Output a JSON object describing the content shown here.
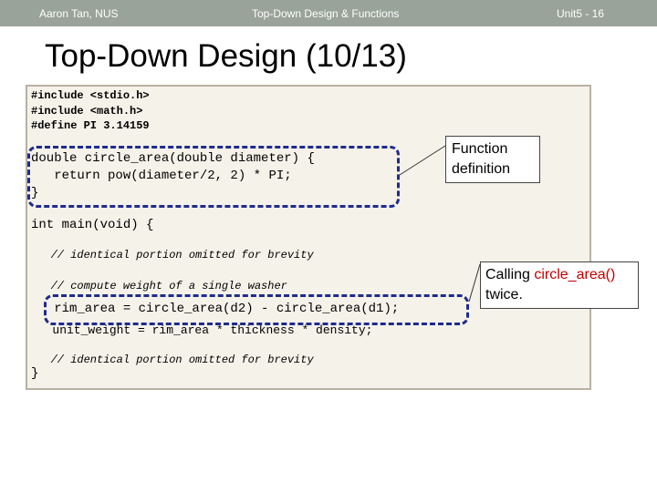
{
  "header": {
    "left": "Aaron Tan, NUS",
    "center": "Top-Down Design & Functions",
    "right": "Unit5 - 16"
  },
  "slide_title": "Top-Down Design (10/13)",
  "code": {
    "include1": "#include <stdio.h>",
    "include2": "#include <math.h>",
    "define": "#define PI 3.14159",
    "func_line1": "double circle_area(double diameter) {",
    "func_line2": "   return pow(diameter/2, 2) * PI;",
    "func_close": "}",
    "main_open": "int main(void) {",
    "comment1": "   // identical portion omitted for brevity",
    "comment2": "   // compute weight of a single washer",
    "rim_line": "   rim_area = circle_area(d2) - circle_area(d1);",
    "unit_line": "   unit_weight = rim_area * thickness * density;",
    "comment3": "   // identical portion omitted for brevity",
    "main_close": "}"
  },
  "callouts": {
    "definition_line1": "Function",
    "definition_line2": "definition",
    "calling_prefix": "Calling ",
    "calling_name": "circle_area()",
    "calling_suffix": "twice."
  },
  "colors": {
    "header_bar": "#9aa39a",
    "code_background": "#f5f2ea",
    "dashed_box": "#1f2b8c",
    "highlight_red": "#c00000"
  }
}
